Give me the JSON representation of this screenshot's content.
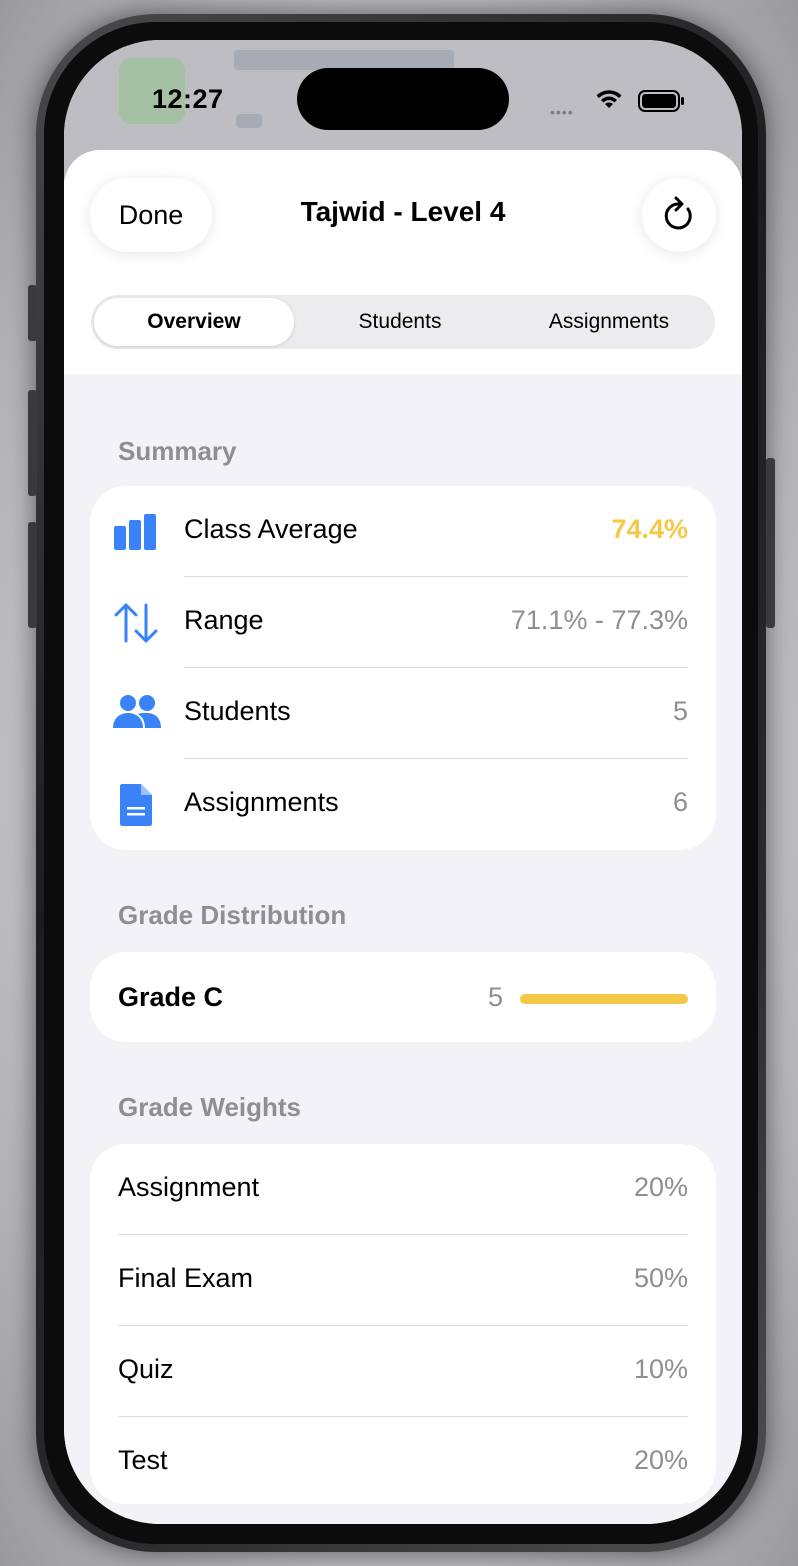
{
  "status_bar": {
    "time": "12:27"
  },
  "sheet": {
    "title": "Tajwid - Level 4",
    "done_label": "Done",
    "refresh_icon": "refresh-icon"
  },
  "tabs": [
    {
      "label": "Overview",
      "selected": true
    },
    {
      "label": "Students",
      "selected": false
    },
    {
      "label": "Assignments",
      "selected": false
    }
  ],
  "summary": {
    "header": "Summary",
    "rows": [
      {
        "icon": "bar-chart-icon",
        "label": "Class Average",
        "value": "74.4%"
      },
      {
        "icon": "sort-arrows-icon",
        "label": "Range",
        "value": "71.1% - 77.3%"
      },
      {
        "icon": "people-icon",
        "label": "Students",
        "value": "5"
      },
      {
        "icon": "document-icon",
        "label": "Assignments",
        "value": "6"
      }
    ]
  },
  "grade_distribution": {
    "header": "Grade Distribution",
    "rows": [
      {
        "label": "Grade C",
        "count": "5",
        "fraction": 1.0
      }
    ]
  },
  "grade_weights": {
    "header": "Grade Weights",
    "rows": [
      {
        "label": "Assignment",
        "value": "20%"
      },
      {
        "label": "Final Exam",
        "value": "50%"
      },
      {
        "label": "Quiz",
        "value": "10%"
      },
      {
        "label": "Test",
        "value": "20%"
      }
    ]
  },
  "colors": {
    "accent_yellow": "#f5c84a",
    "icon_blue": "#3a82f7",
    "secondary_text": "#8e8e93"
  }
}
